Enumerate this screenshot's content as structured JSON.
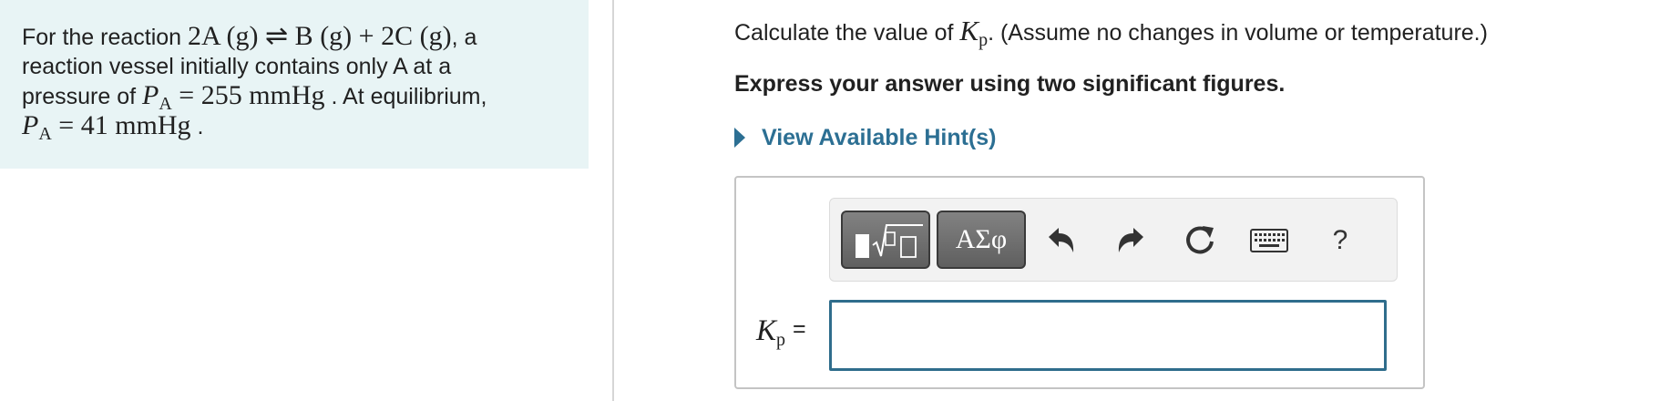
{
  "problem": {
    "line1_prefix": "For the reaction ",
    "reaction": {
      "reactant_coef": "2",
      "reactant": "A",
      "phase": "(g)",
      "arrow": "⇌",
      "product1": "B",
      "plus": "+",
      "product2_coef": "2",
      "product2": "C"
    },
    "line1_suffix": ", a",
    "line2": "reaction vessel initially contains only A at a",
    "line3_prefix": "pressure of ",
    "pressure_symbol": "P",
    "pressure_subscript": "A",
    "equals": "=",
    "initial_value": "255 mmHg",
    "line3_suffix": " . At equilibrium,",
    "equilibrium_value": "41 mmHg",
    "line4_suffix": " ."
  },
  "question": {
    "instruction_prefix": "Calculate the value of ",
    "kp_symbol": "K",
    "kp_subscript": "p",
    "instruction_suffix": ". (Assume no changes in volume or temperature.)",
    "format_note": "Express your answer using two significant figures.",
    "hint_label": "View Available Hint(s)"
  },
  "toolbar": {
    "symbols_label": "ΑΣφ",
    "help_label": "?"
  },
  "answer": {
    "label_symbol": "K",
    "label_subscript": "p",
    "equals": "=",
    "value": ""
  },
  "colors": {
    "panel_bg": "#e8f4f5",
    "link": "#2c6f93",
    "input_border": "#2f6d8c"
  }
}
